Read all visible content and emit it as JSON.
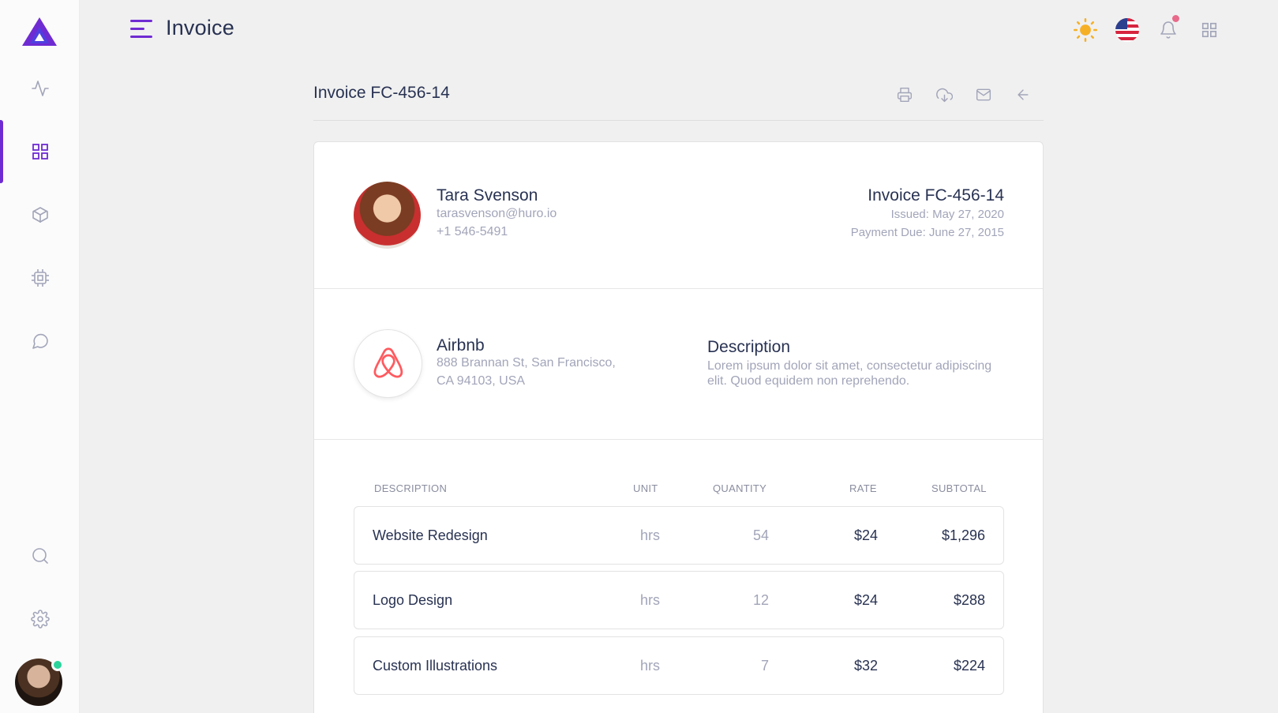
{
  "header": {
    "title": "Invoice"
  },
  "invoice_bar": {
    "title": "Invoice FC-456-14"
  },
  "client": {
    "name": "Tara Svenson",
    "email": "tarasvenson@huro.io",
    "phone": "+1 546-5491"
  },
  "meta": {
    "invoice_no": "Invoice FC-456-14",
    "issued": "Issued: May 27, 2020",
    "due": "Payment Due: June 27, 2015"
  },
  "company": {
    "name": "Airbnb",
    "address_line1": "888 Brannan St, San Francisco,",
    "address_line2": "CA 94103, USA"
  },
  "description": {
    "title": "Description",
    "text": "Lorem ipsum dolor sit amet, consectetur adipiscing elit. Quod equidem non reprehendo."
  },
  "table": {
    "headers": [
      "DESCRIPTION",
      "UNIT",
      "QUANTITY",
      "RATE",
      "SUBTOTAL"
    ],
    "rows": [
      {
        "description": "Website Redesign",
        "unit": "hrs",
        "quantity": "54",
        "rate": "$24",
        "subtotal": "$1,296"
      },
      {
        "description": "Logo Design",
        "unit": "hrs",
        "quantity": "12",
        "rate": "$24",
        "subtotal": "$288"
      },
      {
        "description": "Custom Illustrations",
        "unit": "hrs",
        "quantity": "7",
        "rate": "$32",
        "subtotal": "$224"
      }
    ]
  },
  "colors": {
    "accent": "#6f2bd2",
    "sun": "#f6b026",
    "online": "#2bd49b",
    "notification": "#e8698a",
    "airbnb": "#ff5a5f"
  },
  "icons": {
    "sidebar": [
      "activity-icon",
      "grid-icon",
      "box-icon",
      "cpu-icon",
      "message-circle-icon",
      "search-icon",
      "settings-icon"
    ],
    "topbar": [
      "sun-icon",
      "us-flag-icon",
      "bell-icon",
      "apps-grid-icon"
    ],
    "actions": [
      "printer-icon",
      "download-cloud-icon",
      "mail-icon",
      "arrow-left-icon"
    ]
  }
}
